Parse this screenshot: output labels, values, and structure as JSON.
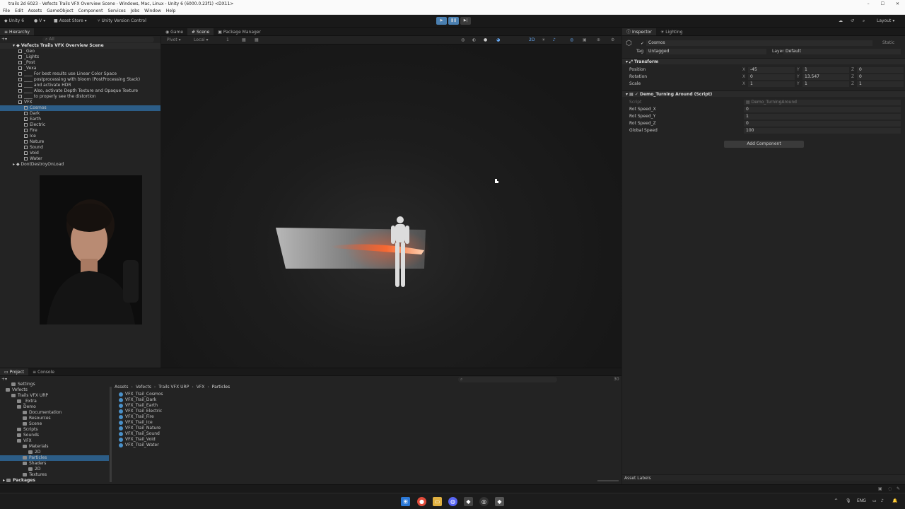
{
  "window": {
    "title": "trails 2d 6023 - Vefects Trails VFX Overview Scene - Windows, Mac, Linux - Unity 6 (6000.0.23f1) <DX11>"
  },
  "menu": [
    "File",
    "Edit",
    "Assets",
    "GameObject",
    "Component",
    "Services",
    "Jobs",
    "Window",
    "Help"
  ],
  "toolbar": {
    "account": "Unity 6",
    "version_control_initial": "V",
    "asset_store": "Asset Store",
    "version_control": "Unity Version Control",
    "layout": "Layout"
  },
  "hierarchy": {
    "tab": "Hierarchy",
    "search_placeholder": "All",
    "scene_name": "Vefects Trails VFX Overview Scene",
    "rows": [
      {
        "label": "_Geo",
        "indent": 1
      },
      {
        "label": "_Lights",
        "indent": 1
      },
      {
        "label": "_Post",
        "indent": 1
      },
      {
        "label": "_Vexa",
        "indent": 1
      },
      {
        "label": "____ For best results use Linear Color Space",
        "indent": 1
      },
      {
        "label": "____ postprocessing with bloom (PostProcessing Stack)",
        "indent": 1
      },
      {
        "label": "____ and activate HDR",
        "indent": 1
      },
      {
        "label": "____ Also, activate Depth Texture and Opaque Texture",
        "indent": 1
      },
      {
        "label": "____ to properly see the distortion",
        "indent": 1
      },
      {
        "label": "VFX",
        "indent": 1
      },
      {
        "label": "Cosmos",
        "indent": 2,
        "selected": true
      },
      {
        "label": "Dark",
        "indent": 2
      },
      {
        "label": "Earth",
        "indent": 2
      },
      {
        "label": "Electric",
        "indent": 2
      },
      {
        "label": "Fire",
        "indent": 2
      },
      {
        "label": "Ice",
        "indent": 2
      },
      {
        "label": "Nature",
        "indent": 2
      },
      {
        "label": "Sound",
        "indent": 2
      },
      {
        "label": "Void",
        "indent": 2
      },
      {
        "label": "Water",
        "indent": 2
      }
    ],
    "dont_destroy": "DontDestroyOnLoad"
  },
  "scene_tabs": [
    "Game",
    "Scene",
    "Package Manager"
  ],
  "scene_toolbar": {
    "pivot": "Pivot",
    "space": "Local",
    "grid_value": "1",
    "mode_2d": "2D"
  },
  "inspector": {
    "tabs": [
      "Inspector",
      "Lighting"
    ],
    "object_name": "Cosmos",
    "static_label": "Static",
    "tag_label": "Tag",
    "tag_value": "Untagged",
    "layer_label": "Layer",
    "layer_value": "Default",
    "transform": {
      "title": "Transform",
      "rows": [
        {
          "label": "Position",
          "x": "-45",
          "y": "1",
          "z": "0"
        },
        {
          "label": "Rotation",
          "x": "0",
          "y": "13.547",
          "z": "0"
        },
        {
          "label": "Scale",
          "x": "1",
          "y": "1",
          "z": "1"
        }
      ]
    },
    "script_component": {
      "title": "Demo_Turning Around (Script)",
      "script_label": "Script",
      "script_value": "Demo_TurningAround",
      "rows": [
        {
          "label": "Rot Speed_X",
          "value": "0"
        },
        {
          "label": "Rot Speed_Y",
          "value": "1"
        },
        {
          "label": "Rot Speed_Z",
          "value": "0"
        },
        {
          "label": "Global Speed",
          "value": "100"
        }
      ]
    },
    "add_component": "Add Component",
    "asset_labels": "Asset Labels"
  },
  "project": {
    "tabs": [
      "Project",
      "Console"
    ],
    "badge_count": "30",
    "breadcrumb": [
      "Assets",
      "Vefects",
      "Trails VFX URP",
      "VFX",
      "Particles"
    ],
    "tree": [
      {
        "label": "Settings",
        "indent": 2
      },
      {
        "label": "Vefects",
        "indent": 1
      },
      {
        "label": "Trails VFX URP",
        "indent": 2
      },
      {
        "label": "_Extra",
        "indent": 3
      },
      {
        "label": "Demo",
        "indent": 3
      },
      {
        "label": "Documentation",
        "indent": 4
      },
      {
        "label": "Resources",
        "indent": 4
      },
      {
        "label": "Scene",
        "indent": 4
      },
      {
        "label": "Scripts",
        "indent": 3
      },
      {
        "label": "Sounds",
        "indent": 3
      },
      {
        "label": "VFX",
        "indent": 3
      },
      {
        "label": "Materials",
        "indent": 4
      },
      {
        "label": "2D",
        "indent": 5
      },
      {
        "label": "Particles",
        "indent": 4,
        "selected": true
      },
      {
        "label": "Shaders",
        "indent": 4
      },
      {
        "label": "2D",
        "indent": 5
      },
      {
        "label": "Textures",
        "indent": 4
      }
    ],
    "packages": "Packages",
    "assets": [
      "VFX_Trail_Cosmos",
      "VFX_Trail_Dark",
      "VFX_Trail_Earth",
      "VFX_Trail_Electric",
      "VFX_Trail_Fire",
      "VFX_Trail_Ice",
      "VFX_Trail_Nature",
      "VFX_Trail_Sound",
      "VFX_Trail_Void",
      "VFX_Trail_Water"
    ]
  },
  "taskbar": {
    "lang": "ENG"
  }
}
